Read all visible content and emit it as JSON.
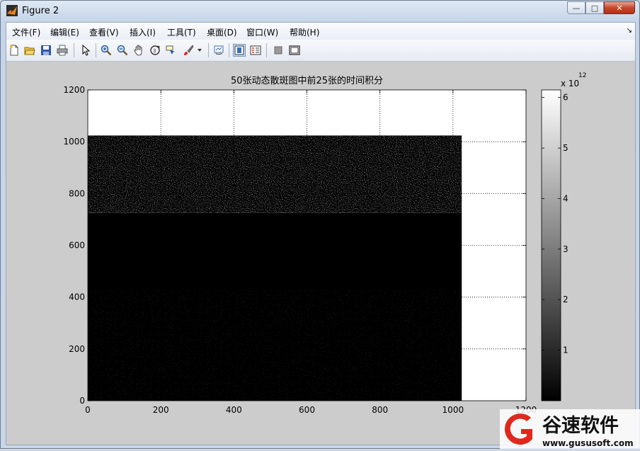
{
  "window": {
    "title": "Figure 2",
    "min_icon": "minimize-icon",
    "max_icon": "maximize-icon",
    "close_icon": "close-icon"
  },
  "menu": [
    {
      "label": "文件(F)"
    },
    {
      "label": "编辑(E)"
    },
    {
      "label": "查看(V)"
    },
    {
      "label": "插入(I)"
    },
    {
      "label": "工具(T)"
    },
    {
      "label": "桌面(D)"
    },
    {
      "label": "窗口(W)"
    },
    {
      "label": "帮助(H)"
    }
  ],
  "toolbar": [
    "new-figure-icon",
    "open-file-icon",
    "save-icon",
    "print-icon",
    "pointer-icon",
    "zoom-in-icon",
    "zoom-out-icon",
    "pan-icon",
    "rotate-3d-icon",
    "data-cursor-icon",
    "brush-icon",
    "brush-dropdown-icon",
    "link-plot-icon",
    "colorbar-toggle-icon",
    "legend-toggle-icon",
    "hide-plot-tools-icon",
    "show-plot-tools-icon"
  ],
  "colors": {
    "figure_bg": "#cccccc",
    "axes_bg": "#ffffff",
    "image_dark": "#000000",
    "accent_red": "#e0281c"
  },
  "chart_data": {
    "type": "heatmap",
    "title": "50张动态散斑图中前25张的时间积分",
    "xlim": [
      0,
      1200
    ],
    "ylim": [
      0,
      1200
    ],
    "xticks": [
      "0",
      "200",
      "400",
      "600",
      "800",
      "1000",
      "1200"
    ],
    "yticks": [
      "0",
      "200",
      "400",
      "600",
      "800",
      "1000",
      "1200"
    ],
    "grid": true,
    "image_extent": {
      "x": [
        0,
        1024
      ],
      "y": [
        0,
        1024
      ]
    },
    "bands": [
      {
        "y": [
          0,
          425
        ],
        "brightness": "low-speckle"
      },
      {
        "y": [
          425,
          725
        ],
        "brightness": "near-black"
      },
      {
        "y": [
          725,
          1024
        ],
        "brightness": "medium-speckle"
      }
    ],
    "colorbar": {
      "ticks": [
        "1",
        "2",
        "3",
        "4",
        "5",
        "6"
      ],
      "tick_values": [
        1,
        2,
        3,
        4,
        5,
        6
      ],
      "range": [
        0,
        6.15
      ],
      "exponent_label": "x 10",
      "exponent": "12",
      "colormap": "gray"
    }
  },
  "watermark": {
    "text": "谷速软件",
    "url": "www.gususoft.com"
  }
}
